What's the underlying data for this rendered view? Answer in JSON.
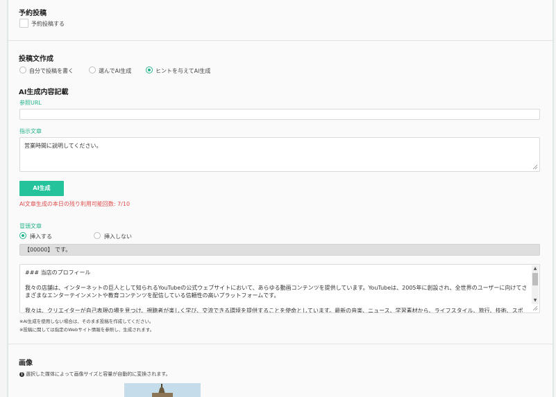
{
  "scheduled": {
    "title": "予約投稿",
    "checkbox_label": "予約投稿する"
  },
  "compose": {
    "title": "投稿文作成",
    "options": [
      "自分で投稿を書く",
      "選んでAI生成",
      "ヒントを与えてAI生成"
    ],
    "selected": "ヒントを与えてAI生成"
  },
  "ai": {
    "title": "AI生成内容記載",
    "url_label": "参照URL",
    "url_value": "",
    "instruction_label": "指示文章",
    "instruction_value": "営業時間に説明してください。",
    "generate_button": "AI生成",
    "remaining_text": "AI文章生成の本日の残り利用可能回数: 7/10"
  },
  "header_text": {
    "label": "冒頭文章",
    "options": [
      "挿入する",
      "挿入しない"
    ],
    "selected": "挿入する",
    "value": "【00000】 です。"
  },
  "body_text": {
    "content": "### 当店のプロフィール\n\n我々の店舗は、インターネットの巨人として知られるYouTubeの公式ウェブサイトにおいて、あらゆる動画コンテンツを提供しています。YouTubeは、2005年に創設され、全世界のユーザーに向けてさまざまなエンターテインメントや教育コンテンツを配信している信頼性の高いプラットフォームです。\n\n我々は、クリエイターが自己表現の場を見つけ、視聴者が楽しく学び、交流できる環境を提供することを使命としています。最新の音楽、ニュース、学習素材から、ライフスタイル、旅行、技術、スポーツ、エンターテインメントなど、ユーザーのニーズに応える幅広いカテゴリのコンテンツが揃っています。"
  },
  "notes": [
    "※AI生成を使用しない場合は、そのまま投稿を作成してください。",
    "※投稿に関しては指定のWebサイト情報を参照し、生成されます。"
  ],
  "image": {
    "title": "画像",
    "info": "選択した媒体によって画像サイズと容量が自動的に変換されます。"
  },
  "colors": {
    "accent": "#25c39c",
    "accent_text": "#25b38c",
    "warning": "#e04b4b",
    "panel_border": "#dfe9e4"
  }
}
